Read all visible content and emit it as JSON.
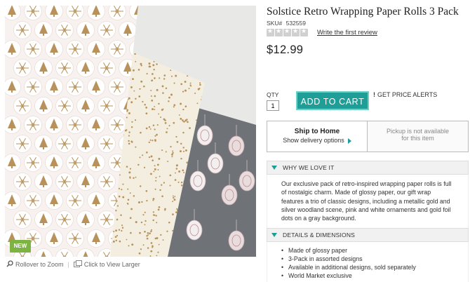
{
  "badge": {
    "new": "NEW"
  },
  "image_controls": {
    "zoom_label": "Rollover to Zoom",
    "larger_label": "Click to View Larger"
  },
  "product": {
    "title": "Solstice Retro Wrapping Paper Rolls 3 Pack",
    "sku_label": "SKU#",
    "sku": "532559",
    "rating": 0,
    "review_link": "Write the first review",
    "price": "$12.99"
  },
  "purchase": {
    "qty_label": "QTY",
    "qty_value": "1",
    "add_to_cart": "ADD TO CART",
    "price_alerts_mark": "!",
    "price_alerts": "GET PRICE ALERTS"
  },
  "shipping": {
    "ship_title": "Ship to Home",
    "ship_sub": "Show delivery options",
    "pickup_line1": "Pickup is not available",
    "pickup_line2": "for this item"
  },
  "why_we_love_it": {
    "heading": "WHY WE LOVE IT",
    "body": "Our exclusive pack of retro-inspired wrapping paper rolls is full of nostalgic charm. Made of glossy paper, our gift wrap features a trio of classic designs, including a metallic gold and silver woodland scene, pink and white ornaments and gold foil dots on a gray background."
  },
  "details": {
    "heading": "DETAILS & DIMENSIONS",
    "items": [
      "Made of glossy paper",
      "3-Pack in assorted designs",
      "Available in additional designs, sold separately",
      "World Market exclusive"
    ]
  },
  "colors": {
    "accent": "#1e9e96",
    "new_badge": "#7cb342",
    "paper_gray": "#6f7378",
    "paper_cream": "#f3eedf",
    "paper_white": "#f7f2ef",
    "gold": "#b8925a"
  }
}
